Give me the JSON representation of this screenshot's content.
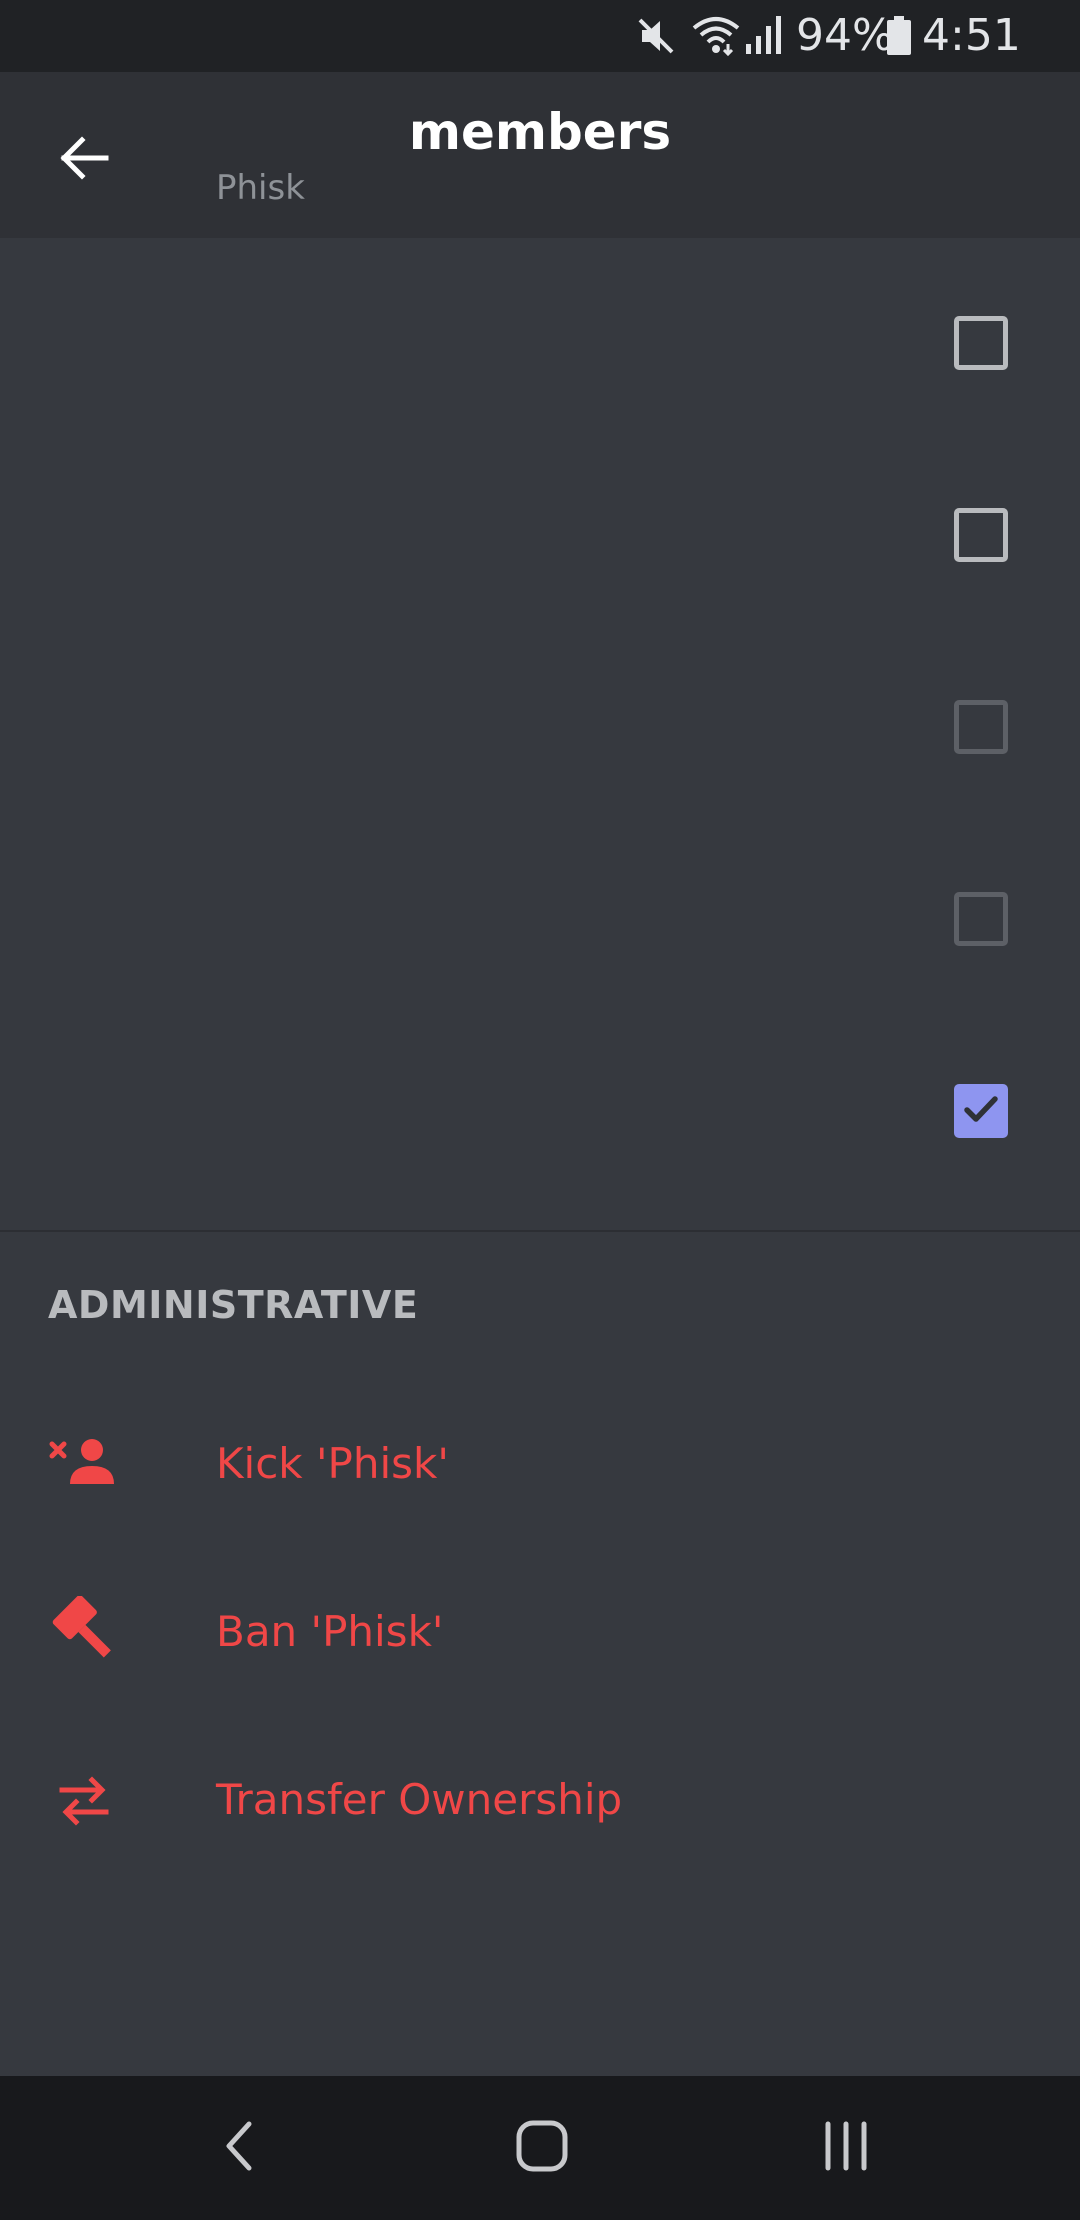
{
  "status_bar": {
    "battery_percent": "94%",
    "time": "4:51",
    "icons": [
      "mute-icon",
      "wifi-icon",
      "signal-icon",
      "battery-icon"
    ]
  },
  "header": {
    "title": "members",
    "subtitle": "Phisk",
    "back_icon": "arrow-left-icon"
  },
  "permissions": [
    {
      "state": "unchecked-enabled"
    },
    {
      "state": "unchecked-enabled"
    },
    {
      "state": "unchecked-disabled"
    },
    {
      "state": "unchecked-disabled"
    },
    {
      "state": "checked"
    }
  ],
  "administrative": {
    "heading": "ADMINISTRATIVE",
    "items": [
      {
        "label": "Kick 'Phisk'",
        "icon": "kick-user-icon"
      },
      {
        "label": "Ban 'Phisk'",
        "icon": "ban-hammer-icon"
      },
      {
        "label": "Transfer Ownership",
        "icon": "transfer-icon"
      }
    ]
  },
  "nav_bar": {
    "icons": [
      "nav-back-icon",
      "nav-home-icon",
      "nav-recents-icon"
    ]
  },
  "colors": {
    "background": "#36393f",
    "header": "#2f3136",
    "danger": "#f04747",
    "accent": "#8e95f0"
  }
}
